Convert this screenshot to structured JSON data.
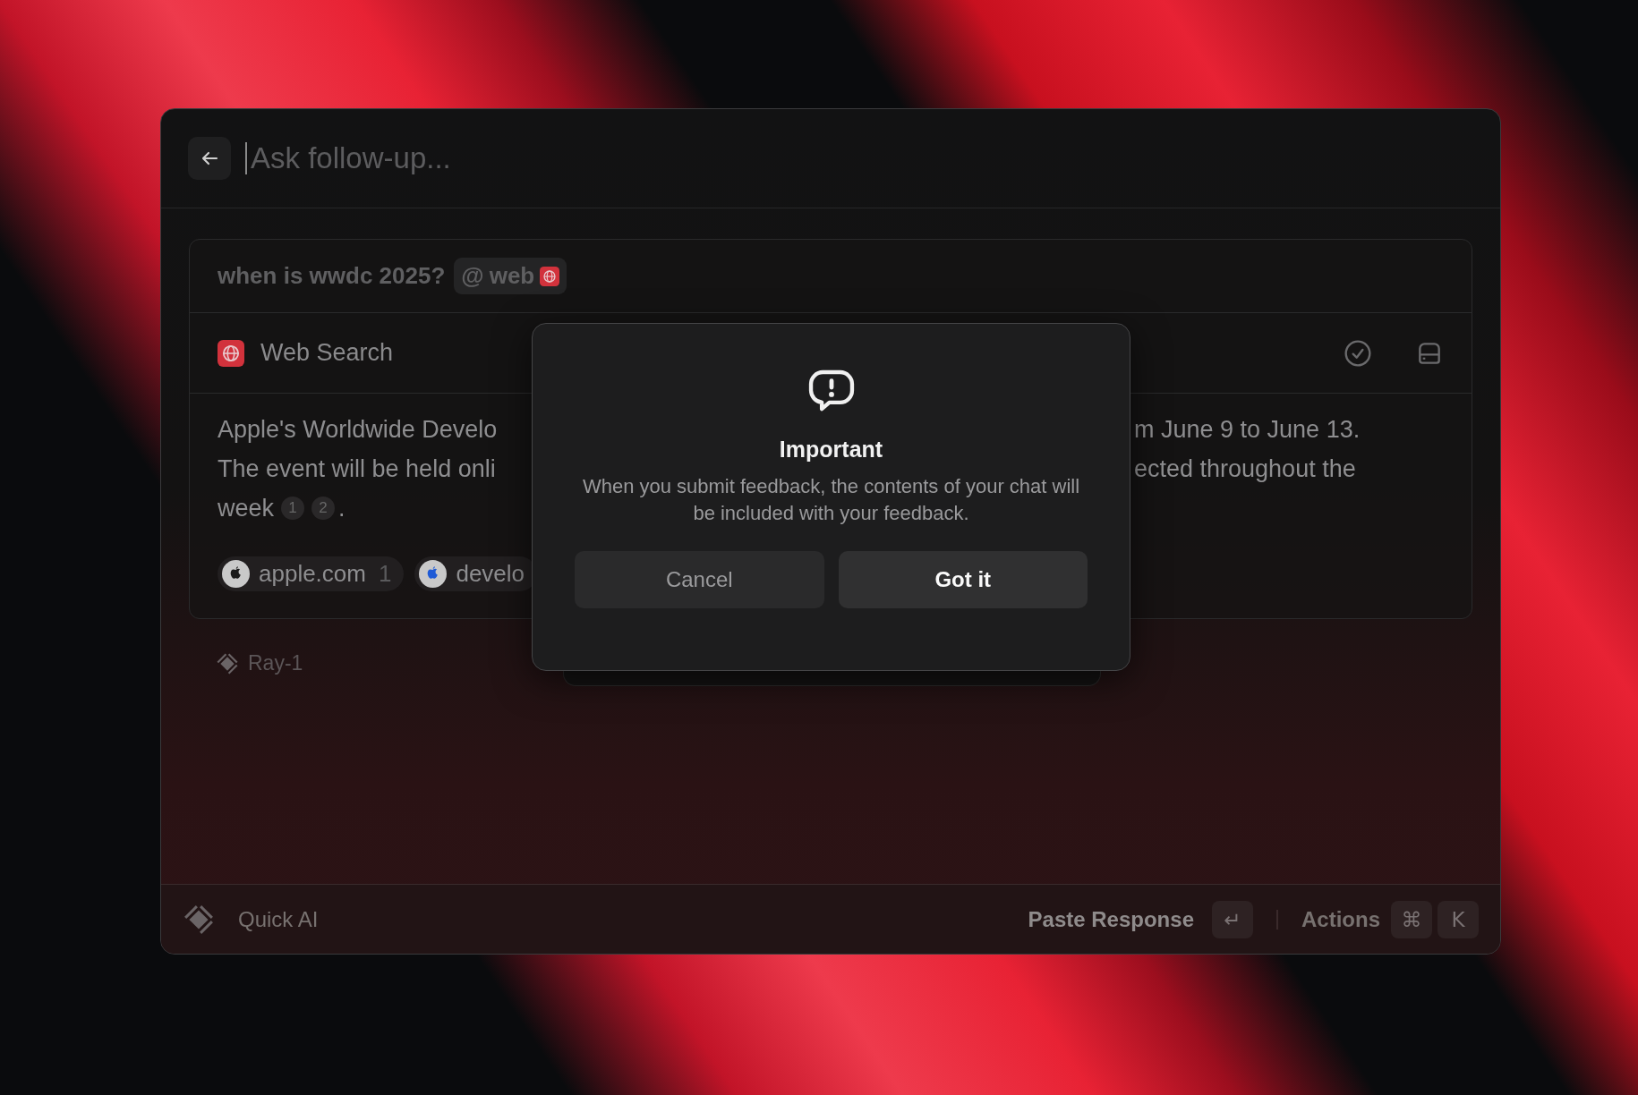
{
  "search": {
    "placeholder": "Ask follow-up..."
  },
  "query": {
    "text": "when is wwdc 2025?",
    "mention_symbol": "@",
    "mention": "web"
  },
  "tool": {
    "label": "Web Search"
  },
  "answer": {
    "lines": [
      {
        "left": "Apple's Worldwide Develo",
        "right": "m June 9 to June 13."
      },
      {
        "left": "The event will be held onli",
        "right": "ected throughout the"
      },
      {
        "left": "week",
        "citations": [
          "1",
          "2"
        ],
        "end": "."
      }
    ]
  },
  "sources": [
    {
      "kind": "apple",
      "domain": "apple.com",
      "count": "1"
    },
    {
      "kind": "developer",
      "domain": "develo"
    }
  ],
  "model": {
    "label": "Ray-1"
  },
  "dialog": {
    "title": "Important",
    "message": "When you submit feedback, the contents of your chat will be included with your feedback.",
    "buttons": [
      {
        "label": "Cancel",
        "kind": "secondary"
      },
      {
        "label": "Got it",
        "kind": "primary"
      }
    ]
  },
  "footer": {
    "title": "Quick AI",
    "primary_action": "Paste Response",
    "primary_key": "↵",
    "actions_label": "Actions",
    "action_keys": [
      "⌘",
      "K"
    ]
  }
}
